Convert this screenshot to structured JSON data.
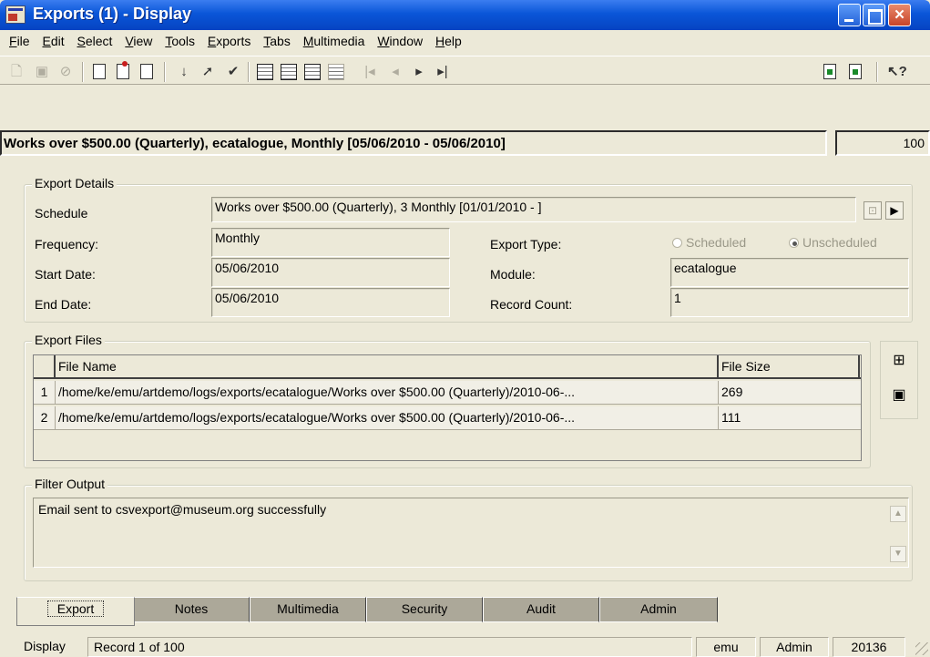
{
  "window": {
    "title": "Exports (1) - Display"
  },
  "menu": [
    "File",
    "Edit",
    "Select",
    "View",
    "Tools",
    "Exports",
    "Tabs",
    "Multimedia",
    "Window",
    "Help"
  ],
  "record": {
    "title": "Works over $500.00 (Quarterly), ecatalogue, Monthly [05/06/2010 - 05/06/2010]",
    "count": "100"
  },
  "export_details": {
    "group_title": "Export Details",
    "schedule_label": "Schedule",
    "schedule_value": "Works over $500.00 (Quarterly), 3 Monthly [01/01/2010 - ]",
    "frequency_label": "Frequency:",
    "frequency_value": "Monthly",
    "start_label": "Start Date:",
    "start_value": "05/06/2010",
    "end_label": "End Date:",
    "end_value": "05/06/2010",
    "export_type_label": "Export Type:",
    "scheduled_label": "Scheduled",
    "unscheduled_label": "Unscheduled",
    "module_label": "Module:",
    "module_value": "ecatalogue",
    "record_count_label": "Record Count:",
    "record_count_value": "1"
  },
  "export_files": {
    "group_title": "Export Files",
    "columns": [
      "File Name",
      "File Size"
    ],
    "rows": [
      {
        "num": "1",
        "name": "/home/ke/emu/artdemo/logs/exports/ecatalogue/Works over $500.00 (Quarterly)/2010-06-...",
        "size": "269"
      },
      {
        "num": "2",
        "name": "/home/ke/emu/artdemo/logs/exports/ecatalogue/Works over $500.00 (Quarterly)/2010-06-...",
        "size": "111"
      }
    ]
  },
  "filter_output": {
    "group_title": "Filter Output",
    "text": "Email sent to csvexport@museum.org successfully"
  },
  "tabs": [
    "Export",
    "Notes",
    "Multimedia",
    "Security",
    "Audit",
    "Admin"
  ],
  "status": {
    "mode": "Display",
    "record": "Record 1 of 100",
    "user": "emu",
    "group": "Admin",
    "id": "20136"
  }
}
